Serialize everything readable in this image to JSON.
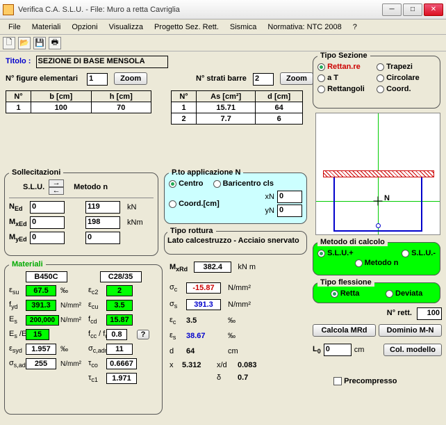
{
  "window": {
    "title": "Verifica C.A. S.L.U. - File: Muro a retta Cavriglia"
  },
  "menu": {
    "file": "File",
    "materiali": "Materiali",
    "opzioni": "Opzioni",
    "visualizza": "Visualizza",
    "progetto": "Progetto Sez. Rett.",
    "sismica": "Sismica",
    "normativa": "Normativa: NTC 2008",
    "help": "?"
  },
  "titolo": {
    "label": "Titolo :",
    "value": "SEZIONE DI BASE MENSOLA"
  },
  "fig": {
    "label": "N° figure elementari",
    "value": "1",
    "zoom": "Zoom"
  },
  "barre": {
    "label": "N° strati barre",
    "value": "2",
    "zoom": "Zoom"
  },
  "tableFig": {
    "h1": "N°",
    "h2": "b [cm]",
    "h3": "h [cm]",
    "rows": [
      [
        "1",
        "100",
        "70"
      ]
    ]
  },
  "tableBar": {
    "h1": "N°",
    "h2": "As [cm²]",
    "h3": "d [cm]",
    "rows": [
      [
        "1",
        "15.71",
        "64"
      ],
      [
        "2",
        "7.7",
        "6"
      ]
    ]
  },
  "soll": {
    "legend": "Sollecitazioni",
    "slu": "S.L.U.",
    "metodon": "Metodo n",
    "NEd_l": "N",
    "NEd_s": "Ed",
    "NEd_v": "0",
    "MxEd_l": "M",
    "MxEd_s": "xEd",
    "MxEd_v": "0",
    "MyEd_l": "M",
    "MyEd_s": "yEd",
    "MyEd_v": "0",
    "r2a": "119",
    "r2au": "kN",
    "r2b": "198",
    "r2bu": "kNm",
    "r2c": "0"
  },
  "pto": {
    "legend": "P.to applicazione N",
    "centro": "Centro",
    "bari": "Baricentro cls",
    "coord": "Coord.[cm]",
    "xN_l": "xN",
    "xN_v": "0",
    "yN_l": "yN",
    "yN_v": "0"
  },
  "tiporott": {
    "legend": "Tipo rottura",
    "text": "Lato calcestruzzo - Acciaio snervato"
  },
  "tiposez": {
    "legend": "Tipo Sezione",
    "rett": "Rettan.re",
    "trap": "Trapezi",
    "at": "a T",
    "circ": "Circolare",
    "rettg": "Rettangoli",
    "coord": "Coord."
  },
  "metodo": {
    "legend": "Metodo di calcolo",
    "slup": "S.L.U.+",
    "slum": "S.L.U.-",
    "metodon": "Metodo n"
  },
  "tipofl": {
    "legend": "Tipo flessione",
    "retta": "Retta",
    "dev": "Deviata"
  },
  "materiali": {
    "legend": "Materiali",
    "acc": "B450C",
    "cls": "C28/35",
    "esu_l": "ε",
    "esu_s": "su",
    "esu_v": "67.5",
    "esu_u": "‰",
    "ec2_l": "ε",
    "ec2_s": "c2",
    "ec2_v": "2",
    "fyd_l": "f",
    "fyd_s": "yd",
    "fyd_v": "391.3",
    "fyd_u": "N/mm²",
    "ecu_l": "ε",
    "ecu_s": "cu",
    "ecu_v": "3.5",
    "Es_l": "E",
    "Es_s": "s",
    "Es_v": "200,000",
    "Es_u": "N/mm²",
    "fcd_l": "f",
    "fcd_s": "cd",
    "fcd_v": "15.87",
    "EsEc_l": "E",
    "EsEc_s": "s",
    "EsEc_l2": " /E",
    "EsEc_s2": "c",
    "EsEc_v": "15",
    "fccfcd_l": "f",
    "fccfcd_s": "cc",
    "fccfcd_l2": " / f",
    "fccfcd_s2": "cd",
    "fccfcd_v": "0.8",
    "q": "?",
    "esyd_l": "ε",
    "esyd_s": "syd",
    "esyd_v": "1.957",
    "esyd_u": "‰",
    "scadm_l": "σ",
    "scadm_s": "c,adm",
    "scadm_v": "11",
    "ssadm_l": "σ",
    "ssadm_s": "s,adm",
    "ssadm_v": "255",
    "ssadm_u": "N/mm²",
    "tco_l": "τ",
    "tco_s": "co",
    "tco_v": "0.6667",
    "tc1_l": "τ",
    "tc1_s": "c1",
    "tc1_v": "1.971"
  },
  "results": {
    "MxRd_l": "M",
    "MxRd_s": "xRd",
    "MxRd_v": "382.4",
    "MxRd_u": "kN m",
    "sc_l": "σ",
    "sc_s": "c",
    "sc_v": "-15.87",
    "sc_u": "N/mm²",
    "ss_l": "σ",
    "ss_s": "s",
    "ss_v": "391.3",
    "ss_u": "N/mm²",
    "ec_l": "ε",
    "ec_s": "c",
    "ec_v": "3.5",
    "ec_u": "‰",
    "es_l": "ε",
    "es_s": "s",
    "es_v": "38.67",
    "es_u": "‰",
    "d_l": "d",
    "d_v": "64",
    "d_u": "cm",
    "x_l": "x",
    "x_v": "5.312",
    "xd_l": "x/d",
    "xd_v": "0.083",
    "delta_l": "δ",
    "delta_v": "0.7"
  },
  "right": {
    "nrett_l": "N° rett.",
    "nrett_v": "100",
    "calcola": "Calcola MRd",
    "dominio": "Dominio M-N",
    "L0_l": "L",
    "L0_s": "0",
    "L0_v": "0",
    "L0_u": "cm",
    "colmod": "Col. modello",
    "precomp": "Precompresso"
  },
  "plot": {
    "N": "N"
  }
}
